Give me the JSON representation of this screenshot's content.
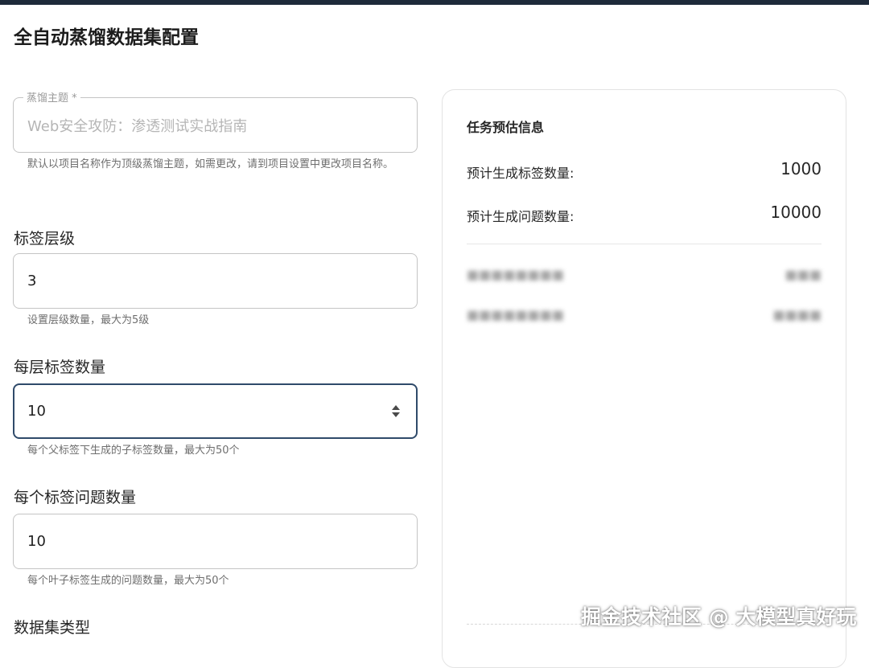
{
  "page": {
    "title": "全自动蒸馏数据集配置"
  },
  "form": {
    "distill_topic": {
      "label": "蒸馏主题 *",
      "value": "Web安全攻防：渗透测试实战指南",
      "helper": "默认以项目名称作为顶级蒸馏主题，如需更改，请到项目设置中更改项目名称。"
    },
    "tag_levels": {
      "label": "标签层级",
      "value": "3",
      "helper": "设置层级数量，最大为5级"
    },
    "tags_per_level": {
      "label": "每层标签数量",
      "value": "10",
      "helper": "每个父标签下生成的子标签数量，最大为50个"
    },
    "questions_per_tag": {
      "label": "每个标签问题数量",
      "value": "10",
      "helper": "每个叶子标签生成的问题数量，最大为50个"
    },
    "dataset_type": {
      "label": "数据集类型"
    }
  },
  "estimate": {
    "title": "任务预估信息",
    "rows": [
      {
        "label": "预计生成标签数量:",
        "value": "1000"
      },
      {
        "label": "预计生成问题数量:",
        "value": "10000"
      }
    ],
    "blurred_rows": [
      {
        "label": "■■■■■■■■",
        "value": "■■■"
      },
      {
        "label": "■■■■■■■■",
        "value": "■■■■"
      }
    ]
  },
  "watermark": {
    "text": "掘金技术社区 @ 大模型真好玩"
  }
}
